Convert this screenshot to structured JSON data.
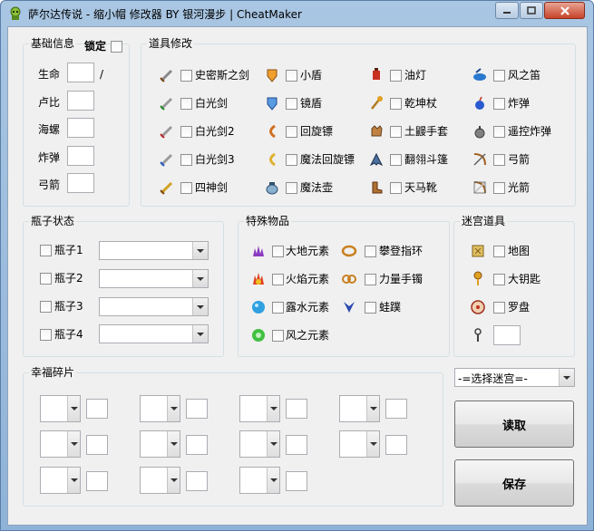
{
  "window": {
    "title": "萨尔达传说 - 缩小帽 修改器 BY 银河漫步 | CheatMaker"
  },
  "basic": {
    "title": "基础信息",
    "lock_label": "锁定",
    "life_label": "生命",
    "life_sep": "/",
    "rupee_label": "卢比",
    "shell_label": "海螺",
    "bomb_label": "炸弹",
    "arrow_label": "弓箭"
  },
  "items": {
    "title": "道具修改",
    "list": [
      "史密斯之剑",
      "小盾",
      "油灯",
      "风之笛",
      "白光剑",
      "镜盾",
      "乾坤杖",
      "炸弹",
      "白光剑2",
      "回旋镖",
      "土鼹手套",
      "遥控炸弹",
      "白光剑3",
      "魔法回旋镖",
      "翻翎斗篷",
      "弓箭",
      "四神剑",
      "魔法壶",
      "天马靴",
      "光箭"
    ]
  },
  "bottles": {
    "title": "瓶子状态",
    "list": [
      "瓶子1",
      "瓶子2",
      "瓶子3",
      "瓶子4"
    ]
  },
  "special": {
    "title": "特殊物品",
    "list": [
      "大地元素",
      "攀登指环",
      "火焰元素",
      "力量手镯",
      "露水元素",
      "蛙蹼",
      "风之元素"
    ]
  },
  "maze": {
    "title": "迷宫道具",
    "list": [
      "地图",
      "大钥匙",
      "罗盘"
    ]
  },
  "fortune": {
    "title": "幸福碎片"
  },
  "right": {
    "dungeon_select": "-=选择迷宫=-",
    "read_button": "读取",
    "save_button": "保存"
  },
  "colors": {
    "titlebar": "#a9c6e3",
    "client": "#f0f0f0",
    "border": "#d5dfe5"
  }
}
